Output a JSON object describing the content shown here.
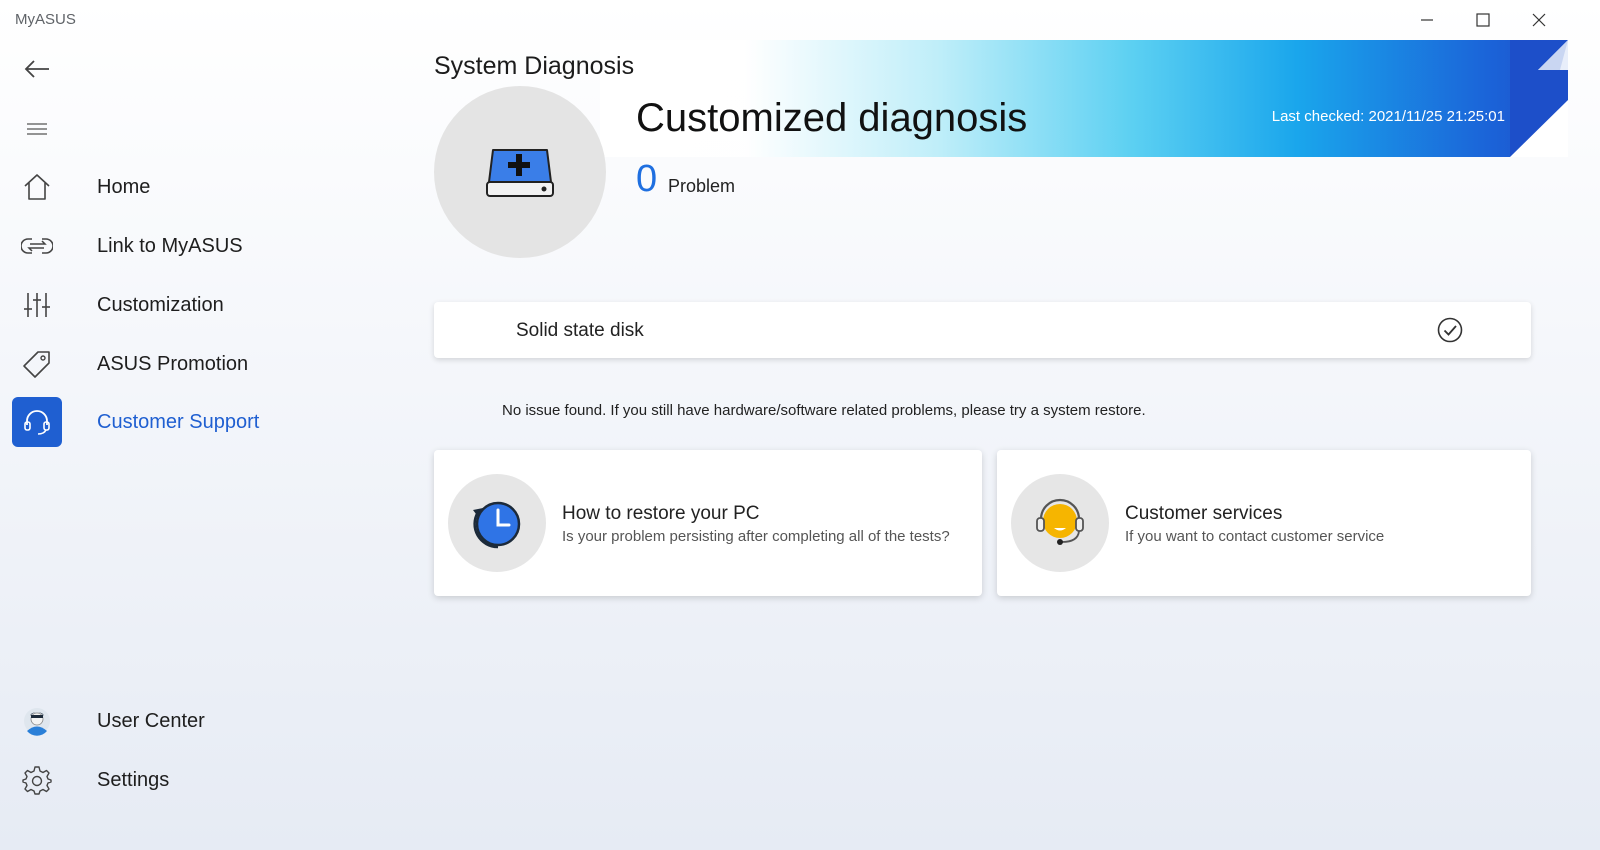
{
  "window": {
    "title": "MyASUS",
    "controls": {
      "minimize_icon": "minimize-icon",
      "maximize_icon": "maximize-icon",
      "close_icon": "close-icon"
    }
  },
  "sidebar": {
    "back_icon": "back-arrow-icon",
    "menu_icon": "hamburger-menu-icon",
    "items": [
      {
        "label": "Home",
        "icon": "home-icon",
        "active": false
      },
      {
        "label": "Link to MyASUS",
        "icon": "link-icon",
        "active": false
      },
      {
        "label": "Customization",
        "icon": "sliders-icon",
        "active": false
      },
      {
        "label": "ASUS Promotion",
        "icon": "tag-icon",
        "active": false
      },
      {
        "label": "Customer Support",
        "icon": "headset-icon",
        "active": true
      }
    ],
    "bottom_items": [
      {
        "label": "User Center",
        "icon": "user-avatar-icon"
      },
      {
        "label": "Settings",
        "icon": "gear-icon"
      }
    ]
  },
  "main": {
    "page_title": "System Diagnosis",
    "hero": {
      "title": "Customized diagnosis",
      "last_checked": "Last checked: 2021/11/25 21:25:01",
      "problem_count": "0",
      "problem_label": "Problem",
      "icon": "disk-plus-icon"
    },
    "results": [
      {
        "label": "Solid state disk",
        "status_icon": "check-circle-icon"
      }
    ],
    "notice": "No issue found. If you still have hardware/software related problems, please try a system restore.",
    "actions": [
      {
        "title": "How to restore your PC",
        "subtitle": "Is your problem persisting after completing all of the tests?",
        "icon": "restore-clock-icon"
      },
      {
        "title": "Customer services",
        "subtitle": "If you want to contact customer service",
        "icon": "customer-service-headset-icon"
      }
    ]
  },
  "colors": {
    "accent": "#1f5fd1",
    "problem_count": "#1f6fe0",
    "banner_end": "#1d4fc9"
  }
}
